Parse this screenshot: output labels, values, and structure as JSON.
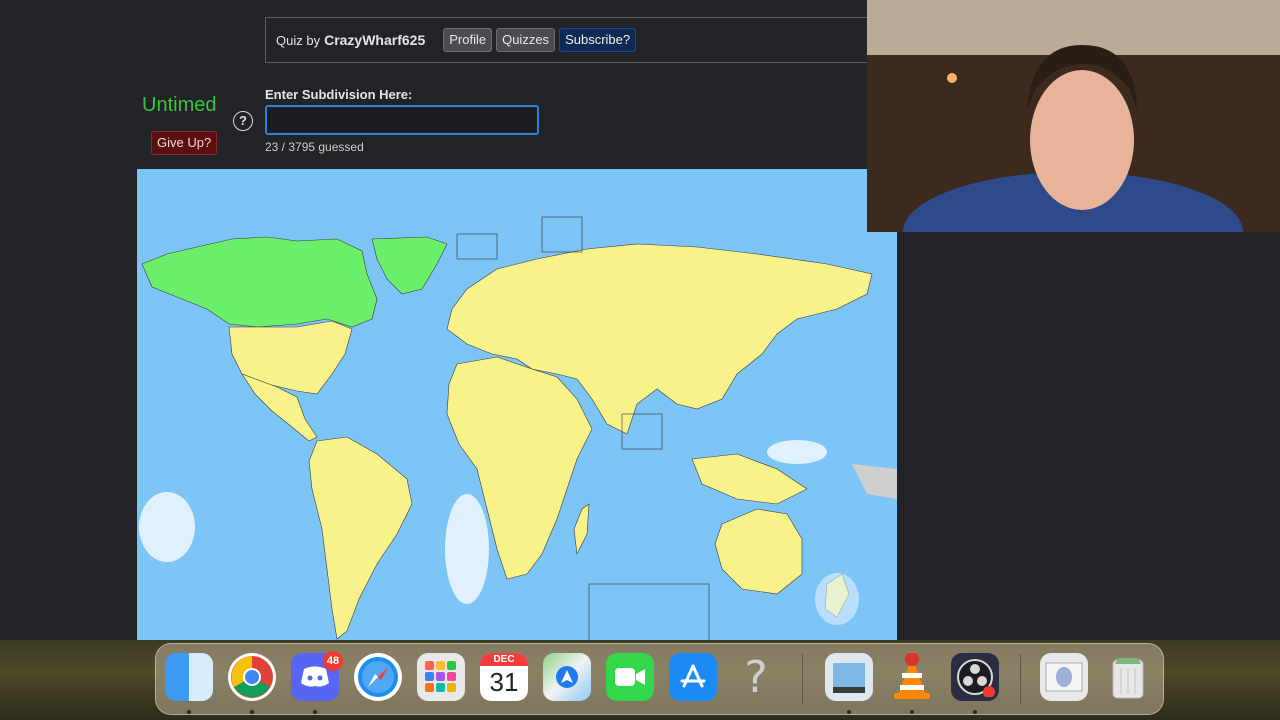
{
  "header": {
    "quiz_by": "Quiz by",
    "author": "CrazyWharf625",
    "buttons": [
      "Profile",
      "Quizzes",
      "Subscribe?"
    ]
  },
  "quiz": {
    "timer_mode": "Untimed",
    "help_symbol": "?",
    "give_up_label": "Give Up?",
    "input_label": "Enter Subdivision Here:",
    "input_value": "",
    "progress": "23 / 3795 guessed"
  },
  "dock": {
    "apps": [
      {
        "name": "Finder",
        "icon": "finder-icon",
        "running": true
      },
      {
        "name": "Chrome",
        "icon": "chrome-icon",
        "running": true
      },
      {
        "name": "Discord",
        "icon": "discord-icon",
        "badge": "48",
        "running": true
      },
      {
        "name": "Safari",
        "icon": "safari-icon",
        "running": false
      },
      {
        "name": "Launchpad",
        "icon": "launchpad-icon",
        "running": false
      },
      {
        "name": "Calendar",
        "icon": "calendar-icon",
        "month": "DEC",
        "day": "31",
        "running": false
      },
      {
        "name": "Maps",
        "icon": "maps-icon",
        "running": false
      },
      {
        "name": "FaceTime",
        "icon": "facetime-icon",
        "running": false
      },
      {
        "name": "App Store",
        "icon": "app-store-icon",
        "running": false
      },
      {
        "name": "Unknown",
        "icon": "question-mark-icon",
        "running": false
      },
      {
        "name": "Preview",
        "icon": "preview-icon",
        "running": true
      },
      {
        "name": "VLC",
        "icon": "vlc-icon",
        "running": true
      },
      {
        "name": "OBS",
        "icon": "obs-icon",
        "running": true
      },
      {
        "name": "Downloads",
        "icon": "downloads-stack-icon",
        "running": false
      },
      {
        "name": "Trash",
        "icon": "trash-icon",
        "running": false
      }
    ]
  },
  "colors": {
    "ocean": "#7dc4f7",
    "land": "#f7f28a",
    "guessed_land": "#6cf06c",
    "timer_green": "#3ec23e",
    "accent_blue": "#3b7be6"
  }
}
